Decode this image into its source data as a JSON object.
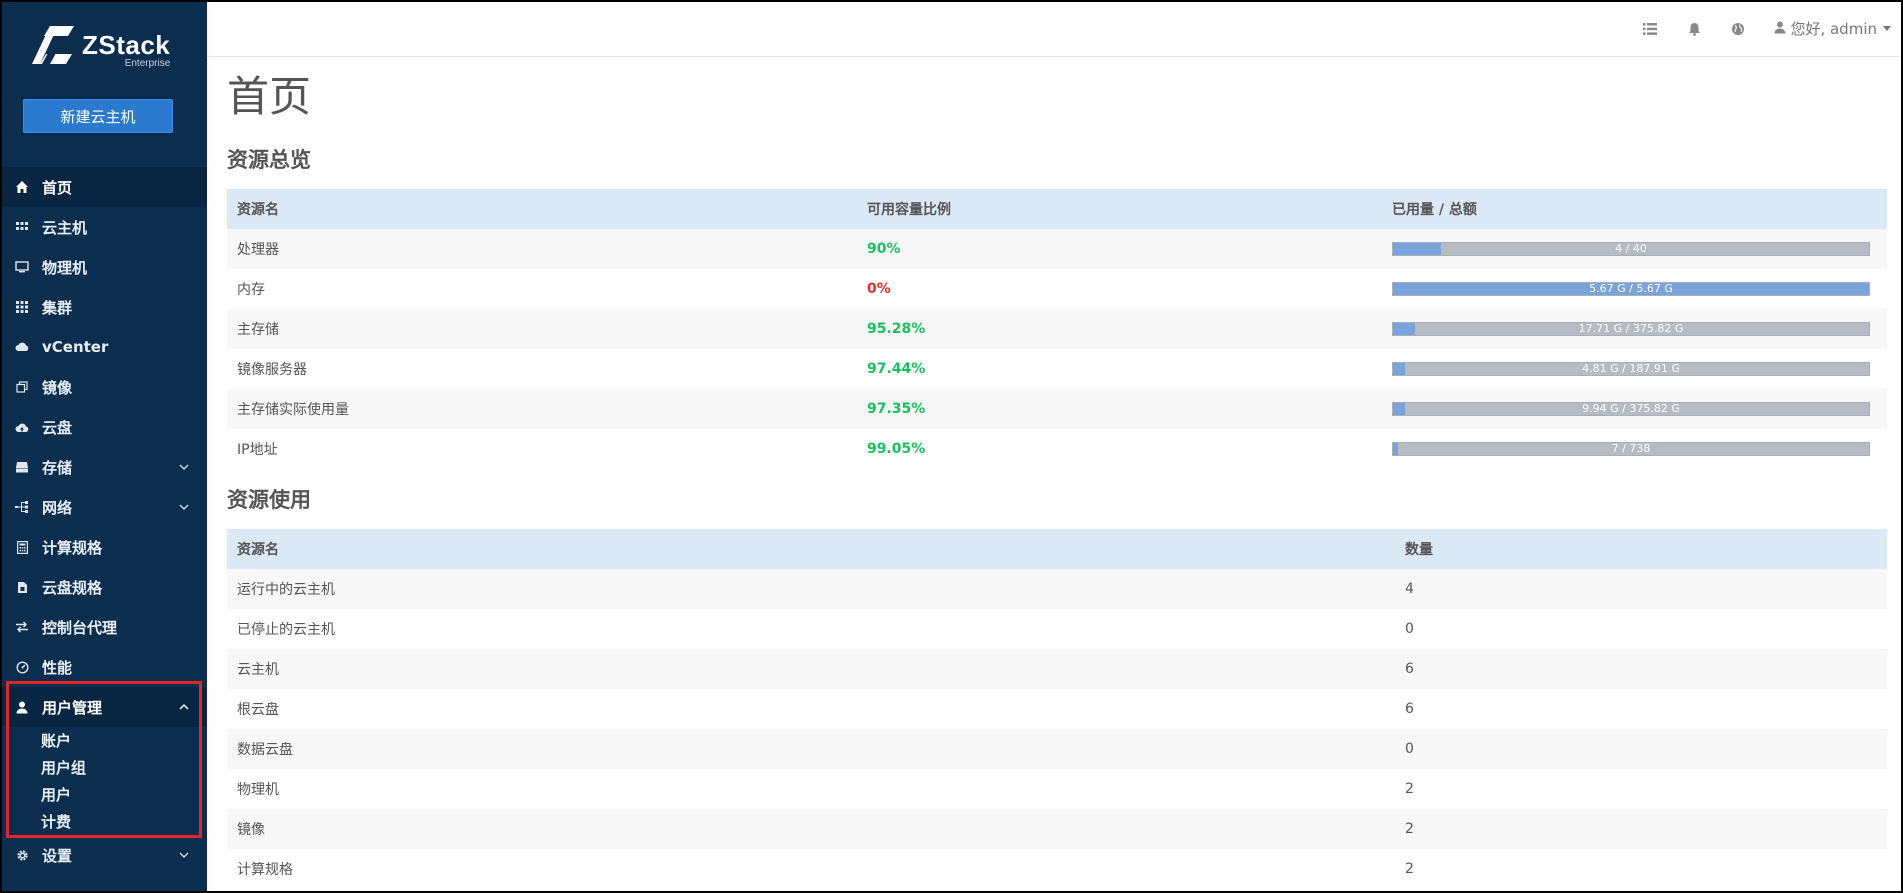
{
  "logo": {
    "name": "ZStack",
    "sub": "Enterprise"
  },
  "sidebar": {
    "new_vm_button": "新建云主机",
    "items": [
      {
        "label": "首页",
        "icon": "home-icon"
      },
      {
        "label": "云主机",
        "icon": "grid-icon"
      },
      {
        "label": "物理机",
        "icon": "monitor-icon"
      },
      {
        "label": "集群",
        "icon": "cluster-icon"
      },
      {
        "label": "vCenter",
        "icon": "cloud-icon"
      },
      {
        "label": "镜像",
        "icon": "copy-icon"
      },
      {
        "label": "云盘",
        "icon": "cloud-upload-icon"
      },
      {
        "label": "存储",
        "icon": "hdd-icon"
      },
      {
        "label": "网络",
        "icon": "network-icon"
      },
      {
        "label": "计算规格",
        "icon": "calculator-icon"
      },
      {
        "label": "云盘规格",
        "icon": "file-icon"
      },
      {
        "label": "控制台代理",
        "icon": "exchange-icon"
      },
      {
        "label": "性能",
        "icon": "dashboard-icon"
      },
      {
        "label": "用户管理",
        "icon": "user-icon"
      },
      {
        "label": "设置",
        "icon": "gear-icon"
      }
    ],
    "user_mgmt_sub": [
      "账户",
      "用户组",
      "用户",
      "计费"
    ]
  },
  "topbar": {
    "greeting": "您好, admin"
  },
  "main": {
    "title": "首页",
    "overview_title": "资源总览",
    "overview_headers": [
      "资源名",
      "可用容量比例",
      "已用量 / 总额"
    ],
    "overview_rows": [
      {
        "name": "处理器",
        "pct": "90%",
        "pct_color": "green",
        "used_fraction": 0.1,
        "usage": "4 / 40"
      },
      {
        "name": "内存",
        "pct": "0%",
        "pct_color": "red",
        "used_fraction": 1.0,
        "usage": "5.67 G / 5.67 G"
      },
      {
        "name": "主存储",
        "pct": "95.28%",
        "pct_color": "green",
        "used_fraction": 0.047,
        "usage": "17.71 G / 375.82 G"
      },
      {
        "name": "镜像服务器",
        "pct": "97.44%",
        "pct_color": "green",
        "used_fraction": 0.026,
        "usage": "4.81 G / 187.91 G"
      },
      {
        "name": "主存储实际使用量",
        "pct": "97.35%",
        "pct_color": "green",
        "used_fraction": 0.026,
        "usage": "9.94 G / 375.82 G"
      },
      {
        "name": "IP地址",
        "pct": "99.05%",
        "pct_color": "green",
        "used_fraction": 0.0095,
        "usage": "7 / 738"
      }
    ],
    "usage_title": "资源使用",
    "usage_headers": [
      "资源名",
      "数量"
    ],
    "usage_rows": [
      {
        "name": "运行中的云主机",
        "count": "4"
      },
      {
        "name": "已停止的云主机",
        "count": "0"
      },
      {
        "name": "云主机",
        "count": "6"
      },
      {
        "name": "根云盘",
        "count": "6"
      },
      {
        "name": "数据云盘",
        "count": "0"
      },
      {
        "name": "物理机",
        "count": "2"
      },
      {
        "name": "镜像",
        "count": "2"
      },
      {
        "name": "计算规格",
        "count": "2"
      }
    ]
  }
}
